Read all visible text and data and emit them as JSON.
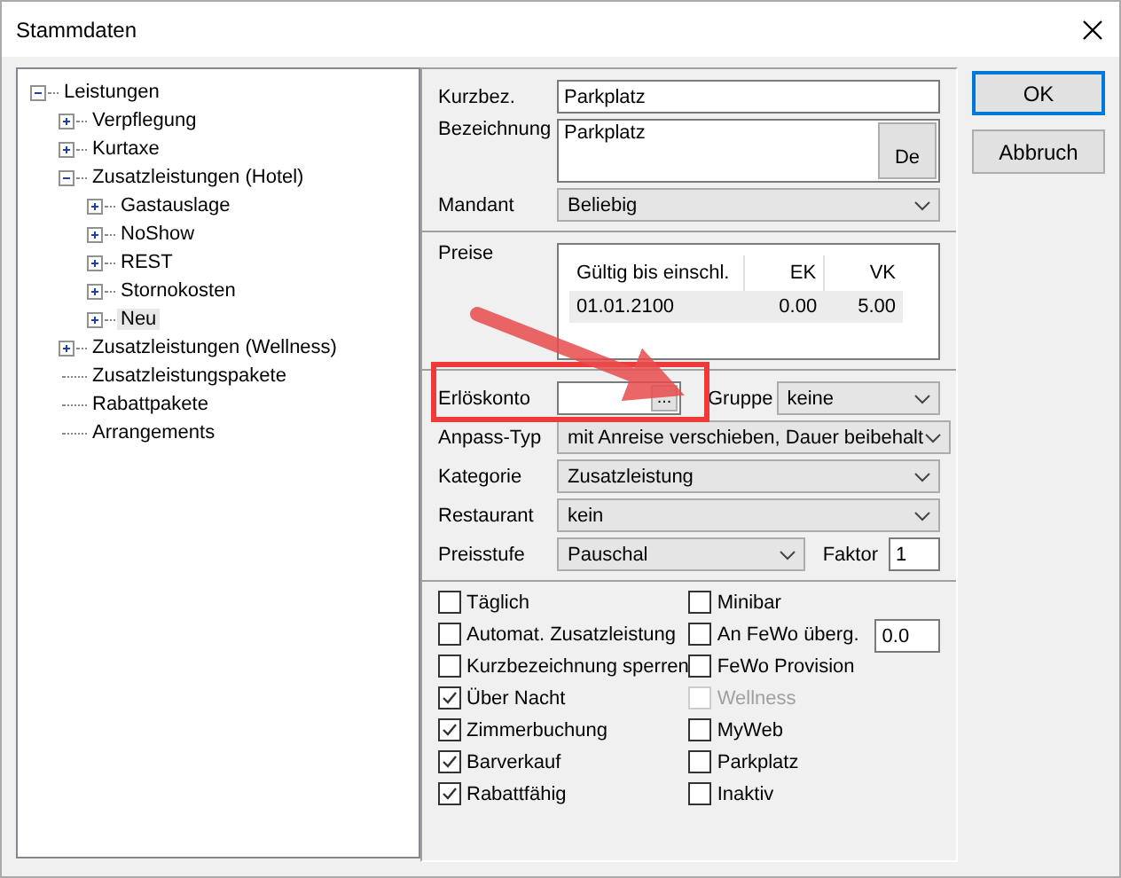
{
  "window": {
    "title": "Stammdaten"
  },
  "tree": [
    {
      "label": "Leistungen",
      "expanded": true,
      "selected": false,
      "children": [
        {
          "label": "Verpflegung",
          "expanded": false,
          "selected": false
        },
        {
          "label": "Kurtaxe",
          "expanded": false,
          "selected": false
        },
        {
          "label": "Zusatzleistungen (Hotel)",
          "expanded": true,
          "selected": false,
          "children": [
            {
              "label": "Gastauslage",
              "expanded": false,
              "selected": false
            },
            {
              "label": "NoShow",
              "expanded": false,
              "selected": false
            },
            {
              "label": "REST",
              "expanded": false,
              "selected": false
            },
            {
              "label": "Stornokosten",
              "expanded": false,
              "selected": false
            },
            {
              "label": "Neu",
              "expanded": false,
              "selected": true
            }
          ]
        },
        {
          "label": "Zusatzleistungen (Wellness)",
          "expanded": false,
          "selected": false
        },
        {
          "label": "Zusatzleistungspakete",
          "selected": false
        },
        {
          "label": "Rabattpakete",
          "selected": false
        },
        {
          "label": "Arrangements",
          "selected": false
        }
      ]
    }
  ],
  "form": {
    "kurzbez": {
      "label": "Kurzbez.",
      "value": "Parkplatz"
    },
    "bezeichnung": {
      "label": "Bezeichnung",
      "value": "Parkplatz",
      "button": "De"
    },
    "mandant": {
      "label": "Mandant",
      "value": "Beliebig"
    },
    "preise": {
      "label": "Preise",
      "columns": [
        "Gültig bis einschl.",
        "EK",
        "VK"
      ],
      "rows": [
        [
          "01.01.2100",
          "0.00",
          "5.00"
        ]
      ]
    },
    "erloeskonto": {
      "label": "Erlöskonto",
      "button": "...",
      "gruppe_label": "Gruppe",
      "gruppe": "keine"
    },
    "combos": [
      {
        "label": "Anpass-Typ",
        "value": "mit Anreise verschieben, Dauer beibehalt"
      },
      {
        "label": "Kategorie",
        "value": "Zusatzleistung"
      },
      {
        "label": "Restaurant",
        "value": "kein"
      }
    ],
    "preisstufe": {
      "label": "Preisstufe",
      "value": "Pauschal",
      "faktor_label": "Faktor",
      "faktor": "1"
    },
    "checks_left": [
      {
        "label": "Täglich",
        "checked": false,
        "disabled": false
      },
      {
        "label": "Automat. Zusatzleistung",
        "checked": false,
        "disabled": false
      },
      {
        "label": "Kurzbezeichnung sperren",
        "checked": false,
        "disabled": false
      },
      {
        "label": "Über Nacht",
        "checked": true,
        "disabled": false
      },
      {
        "label": "Zimmerbuchung",
        "checked": true,
        "disabled": false
      },
      {
        "label": "Barverkauf",
        "checked": true,
        "disabled": false
      },
      {
        "label": "Rabattfähig",
        "checked": true,
        "disabled": false
      }
    ],
    "checks_right": [
      {
        "label": "Minibar",
        "checked": false,
        "disabled": false
      },
      {
        "label": "An FeWo überg.",
        "checked": false,
        "disabled": false,
        "field": "0.0"
      },
      {
        "label": "FeWo Provision",
        "checked": false,
        "disabled": false
      },
      {
        "label": "Wellness",
        "checked": false,
        "disabled": true
      },
      {
        "label": "MyWeb",
        "checked": false,
        "disabled": false
      },
      {
        "label": "Parkplatz",
        "checked": false,
        "disabled": false
      },
      {
        "label": "Inaktiv",
        "checked": false,
        "disabled": false
      }
    ]
  },
  "buttons": [
    {
      "label": "OK",
      "default": true
    },
    {
      "label": "Abbruch",
      "default": false
    }
  ]
}
